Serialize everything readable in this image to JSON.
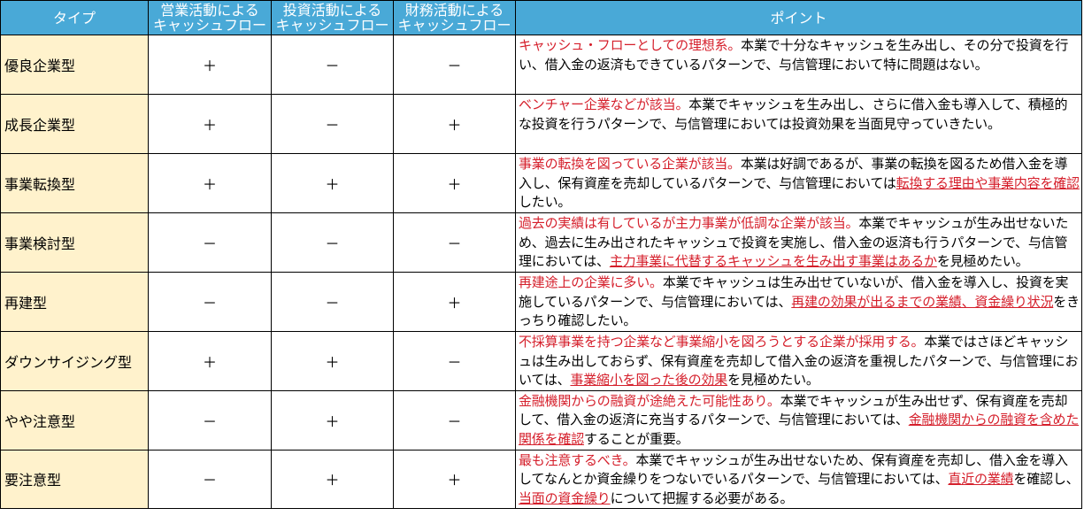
{
  "header": {
    "type_label": "タイプ",
    "operating_cf": [
      "営業活動による",
      "キャッシュフロー"
    ],
    "investing_cf": [
      "投資活動による",
      "キャッシュフロー"
    ],
    "financing_cf": [
      "財務活動による",
      "キャッシュフロー"
    ],
    "point_label": "ポイント"
  },
  "rows": [
    {
      "type": "優良企業型",
      "operating": "＋",
      "investing": "－",
      "financing": "－",
      "point": [
        {
          "t": "キャッシュ・フローとしての理想系。",
          "s": "red"
        },
        {
          "t": "本業で十分なキャッシュを生み出し、その分で投資を行い、借入金の返済もできているパターンで、与信管理において特に問題はない。",
          "s": ""
        }
      ]
    },
    {
      "type": "成長企業型",
      "operating": "＋",
      "investing": "－",
      "financing": "＋",
      "point": [
        {
          "t": "ベンチャー企業などが該当。",
          "s": "red"
        },
        {
          "t": "本業でキャッシュを生み出し、さらに借入金も導入して、積極的な投資を行うパターンで、与信管理においては投資効果を当面見守っていきたい。",
          "s": ""
        }
      ]
    },
    {
      "type": "事業転換型",
      "operating": "＋",
      "investing": "＋",
      "financing": "＋",
      "point": [
        {
          "t": "事業の転換を図っている企業が該当。",
          "s": "red"
        },
        {
          "t": "本業は好調であるが、事業の転換を図るため借入金を導入し、保有資産を売却しているパターンで、与信管理においては",
          "s": ""
        },
        {
          "t": "転換する理由や事業内容を確認",
          "s": "red-u"
        },
        {
          "t": "したい。",
          "s": ""
        }
      ]
    },
    {
      "type": "事業検討型",
      "operating": "－",
      "investing": "－",
      "financing": "－",
      "point": [
        {
          "t": "過去の実績は有しているが主力事業が低調な企業が該当。",
          "s": "red"
        },
        {
          "t": "本業でキャッシュが生み出せないため、過去に生み出されたキャッシュで投資を実施し、借入金の返済も行うパターンで、与信管理においては、",
          "s": ""
        },
        {
          "t": "主力事業に代替するキャッシュを生み出す事業はあるか",
          "s": "red-u"
        },
        {
          "t": "を見極めたい。",
          "s": ""
        }
      ]
    },
    {
      "type": "再建型",
      "operating": "－",
      "investing": "－",
      "financing": "＋",
      "point": [
        {
          "t": "再建途上の企業に多い。",
          "s": "red"
        },
        {
          "t": "本業でキャッシュは生み出せていないが、借入金を導入し、投資を実施しているパターンで、与信管理においては、",
          "s": ""
        },
        {
          "t": "再建の効果が出るまでの業績、資金繰り状況",
          "s": "red-u"
        },
        {
          "t": "をきっちり確認したい。",
          "s": ""
        }
      ]
    },
    {
      "type": "ダウンサイジング型",
      "operating": "＋",
      "investing": "＋",
      "financing": "－",
      "point": [
        {
          "t": "不採算事業を持つ企業など事業縮小を図ろうとする企業が採用する。",
          "s": "red"
        },
        {
          "t": "本業ではさほどキャッシュは生み出しておらず、保有資産を売却して借入金の返済を重視したパターンで、与信管理においては、",
          "s": ""
        },
        {
          "t": "事業縮小を図った後の効果",
          "s": "red-u"
        },
        {
          "t": "を見極めたい。",
          "s": ""
        }
      ]
    },
    {
      "type": "やや注意型",
      "operating": "－",
      "investing": "＋",
      "financing": "－",
      "point": [
        {
          "t": "金融機関からの融資が途絶えた可能性あり。",
          "s": "red"
        },
        {
          "t": "本業でキャッシュが生み出せず、保有資産を売却して、借入金の返済に充当するパターンで、与信管理においては、",
          "s": ""
        },
        {
          "t": "金融機関からの融資を含めた関係を確認",
          "s": "red-u"
        },
        {
          "t": "することが重要。",
          "s": ""
        }
      ]
    },
    {
      "type": "要注意型",
      "operating": "－",
      "investing": "＋",
      "financing": "＋",
      "point": [
        {
          "t": "最も注意するべき。",
          "s": "red"
        },
        {
          "t": "本業でキャッシュが生み出せないため、保有資産を売却し、借入金を導入してなんとか資金繰りをつないでいるパターンで、与信管理においては、",
          "s": ""
        },
        {
          "t": "直近の業績",
          "s": "red-u"
        },
        {
          "t": "を確認し、",
          "s": ""
        },
        {
          "t": "当面の資金繰り",
          "s": "red-u"
        },
        {
          "t": "について把握する必要がある。",
          "s": ""
        }
      ]
    }
  ]
}
